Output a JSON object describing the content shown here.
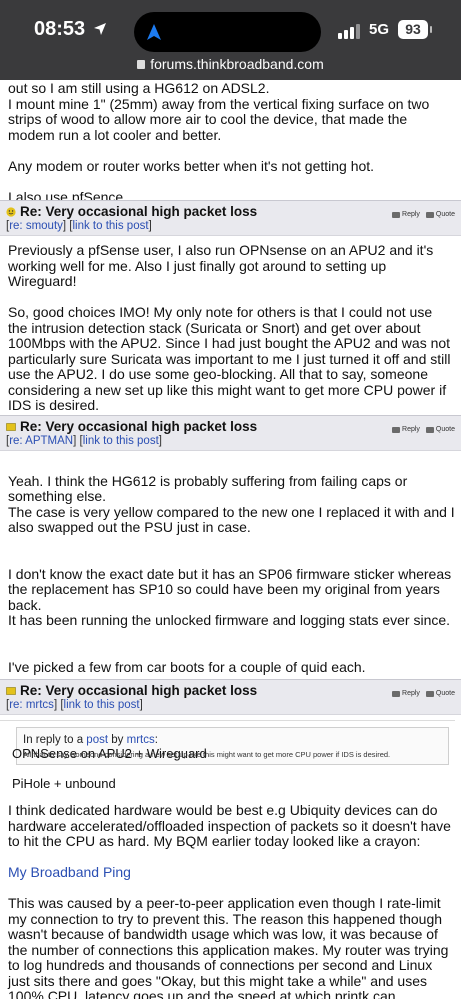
{
  "status_bar": {
    "time": "08:53",
    "network": "5G",
    "battery": "93"
  },
  "browser": {
    "url": "forums.thinkbroadband.com"
  },
  "post0": {
    "lines": [
      "out so I am still using a HG612 on ADSL2.",
      "I mount mine 1\" (25mm) away from the vertical fixing surface on two strips of wood to allow more air to cool the device, that made the modem run a lot cooler and better.",
      "Any modem or router works better when it's not getting hot.",
      "I also use pfSence."
    ]
  },
  "post1": {
    "title": "Re: Very occasional high packet loss",
    "re_label": "re: smouty",
    "link_label": "link to this post",
    "reply_label": "Reply",
    "quote_label": "Quote",
    "paragraphs": [
      "Previously a pfSense user, I also run OPNsense on an APU2 and it's working well for me. Also I just finally got around to setting up Wireguard!",
      "So, good choices IMO! My only note for others is that I could not use the intrusion detection stack (Suricata or Snort) and get over about 100Mbps with the APU2. Since I had just bought the APU2 and was not particularly sure Suricata was important to me I just turned it off and still use the APU2. I do use some geo-blocking. All that to say, someone considering a new set up like this might want to get more CPU power if IDS is desired."
    ]
  },
  "post2": {
    "title": "Re: Very occasional high packet loss",
    "re_label": "re: APTMAN",
    "link_label": "link to this post",
    "reply_label": "Reply",
    "quote_label": "Quote",
    "paragraphs": [
      "Yeah. I think the HG612 is probably suffering from failing caps or something else.\nThe case is very yellow compared to the new one I replaced it with and I also swapped out the PSU just in case.",
      "I don't know the exact date but it has an SP06 firmware sticker whereas the replacement has SP10 so could have been my original from years back.\nIt has been running the unlocked firmware and logging stats ever since.",
      "I've picked a few from car boots for a couple of quid each."
    ],
    "signature": [
      "OPNSense on APU2 + Wireguard",
      "PiHole + unbound"
    ]
  },
  "post3": {
    "title": "Re: Very occasional high packet loss",
    "re_label": "re: mrtcs",
    "link_label": "link to this post",
    "reply_label": "Reply",
    "quote_label": "Quote",
    "quote": {
      "prefix": "In reply to a",
      "post_link": "post",
      "by": "by",
      "author": "mrtcs",
      "suffix": ":",
      "text": "All that to say, someone considering a new set up like this might want to get more CPU power if IDS is desired."
    },
    "paragraphs": [
      "I think dedicated hardware would be best e.g Ubiquity devices can do hardware accelerated/offloaded inspection of packets so it doesn't have to hit the CPU as hard. My BQM earlier today looked like a crayon:",
      "This was caused by a peer-to-peer application even though I rate-limit my connection to try to prevent this. The reason this happened though wasn't because of bandwidth usage which was low, it was because of the number of connections this application makes. My router was trying to log hundreds and thousands of connections per second and Linux just sits there and goes \"Okay, but this might take a while\" and uses 100% CPU, latency goes up and the speed at which printk can output/log"
    ],
    "link_text": "My Broadband Ping"
  },
  "colors": {
    "header_bg": "#e9e9ee",
    "link": "#2b4fb3",
    "topbar": "#3a3a3c",
    "accent_blue": "#1d7cf2"
  }
}
